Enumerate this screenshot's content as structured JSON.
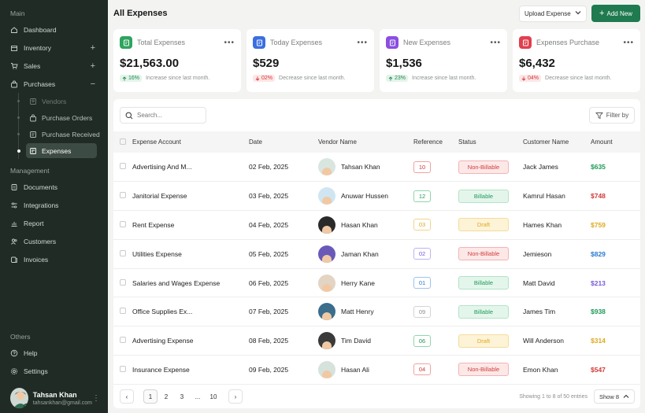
{
  "sidebar": {
    "main_label": "Main",
    "management_label": "Management",
    "others_label": "Others",
    "main_items": [
      {
        "label": "Dashboard",
        "icon": "home-icon"
      },
      {
        "label": "Inventory",
        "icon": "box-icon",
        "trail": "+"
      },
      {
        "label": "Sales",
        "icon": "cart-icon",
        "trail": "+"
      },
      {
        "label": "Purchases",
        "icon": "bag-icon",
        "trail": "−"
      }
    ],
    "purchase_subitems": [
      {
        "label": "Vendors",
        "icon": "vendor-icon"
      },
      {
        "label": "Purchase Orders",
        "icon": "bag-icon"
      },
      {
        "label": "Purchase Received",
        "icon": "receipt-icon"
      },
      {
        "label": "Expenses",
        "icon": "expense-icon"
      }
    ],
    "management_items": [
      {
        "label": "Documents",
        "icon": "document-icon"
      },
      {
        "label": "Integrations",
        "icon": "sliders-icon"
      },
      {
        "label": "Report",
        "icon": "chart-icon"
      },
      {
        "label": "Customers",
        "icon": "users-icon"
      },
      {
        "label": "Invoices",
        "icon": "invoice-icon"
      }
    ],
    "other_items": [
      {
        "label": "Help",
        "icon": "help-icon"
      },
      {
        "label": "Settings",
        "icon": "gear-icon"
      }
    ],
    "profile": {
      "name": "Tahsan Khan",
      "email": "tahsankhan@gmail.com"
    }
  },
  "header": {
    "title": "All Expenses",
    "upload_label": "Upload Expense",
    "add_label": "Add New"
  },
  "cards": [
    {
      "title": "Total Expenses",
      "value": "$21,563.00",
      "change": "16%",
      "direction": "up",
      "note": "Increase since last month.",
      "color": "#2fa35f"
    },
    {
      "title": "Today Expenses",
      "value": "$529",
      "change": "02%",
      "direction": "down",
      "note": "Decrease since last month.",
      "color": "#3b6fe0"
    },
    {
      "title": "New Expenses",
      "value": "$1,536",
      "change": "23%",
      "direction": "up",
      "note": "Increase since last month.",
      "color": "#8a4fe0"
    },
    {
      "title": "Expenses Purchase",
      "value": "$6,432",
      "change": "04%",
      "direction": "down",
      "note": "Decrease since last month.",
      "color": "#e0404f"
    }
  ],
  "table": {
    "search_placeholder": "Search...",
    "filter_label": "Filter by",
    "columns": [
      "Expense Account",
      "Date",
      "Vendor Name",
      "Reference",
      "Status",
      "Customer Name",
      "Amount"
    ],
    "rows": [
      {
        "account": "Advertising And M...",
        "date": "02 Feb, 2025",
        "vendor": "Tahsan Khan",
        "ref": "10",
        "ref_color": "red",
        "status": "Non-Billable",
        "status_kind": "nonbill",
        "customer": "Jack James",
        "amount": "$635",
        "amount_color": "#1e9a57",
        "av_bg": "#d9e6e0"
      },
      {
        "account": "Janitorial Expense",
        "date": "03 Feb, 2025",
        "vendor": "Anuwar Hussen",
        "ref": "12",
        "ref_color": "green",
        "status": "Billable",
        "status_kind": "bill",
        "customer": "Kamrul Hasan",
        "amount": "$748",
        "amount_color": "#d23a3a",
        "av_bg": "#cfe6f2"
      },
      {
        "account": "Rent Expense",
        "date": "04 Feb, 2025",
        "vendor": "Hasan Khan",
        "ref": "03",
        "ref_color": "yellow",
        "status": "Draft",
        "status_kind": "draft",
        "customer": "Hames Khan",
        "amount": "$759",
        "amount_color": "#e0a91e",
        "av_bg": "#2a2a2a"
      },
      {
        "account": "Utilities Expense",
        "date": "05 Feb, 2025",
        "vendor": "Jaman Khan",
        "ref": "02",
        "ref_color": "purple",
        "status": "Non-Billable",
        "status_kind": "nonbill",
        "customer": "Jemieson",
        "amount": "$829",
        "amount_color": "#2a7bd0",
        "av_bg": "#6a59b8"
      },
      {
        "account": "Salaries and Wages Expense",
        "date": "06 Feb, 2025",
        "vendor": "Herry Kane",
        "ref": "01",
        "ref_color": "blue",
        "status": "Billable",
        "status_kind": "bill",
        "customer": "Matt David",
        "amount": "$213",
        "amount_color": "#7a5bd6",
        "av_bg": "#e3d4c3"
      },
      {
        "account": "Office Supplies Ex...",
        "date": "07 Feb, 2025",
        "vendor": "Matt Henry",
        "ref": "09",
        "ref_color": "gray",
        "status": "Billable",
        "status_kind": "bill",
        "customer": "James Tim",
        "amount": "$938",
        "amount_color": "#1e9a57",
        "av_bg": "#3b6d8c"
      },
      {
        "account": "Advertising Expense",
        "date": "08 Feb, 2025",
        "vendor": "Tim David",
        "ref": "06",
        "ref_color": "green",
        "status": "Draft",
        "status_kind": "draft",
        "customer": "Will Anderson",
        "amount": "$314",
        "amount_color": "#e0a91e",
        "av_bg": "#3a3a3a"
      },
      {
        "account": "Insurance Expense",
        "date": "09 Feb, 2025",
        "vendor": "Hasan Ali",
        "ref": "04",
        "ref_color": "red",
        "status": "Non-Billable",
        "status_kind": "nonbill",
        "customer": "Emon Khan",
        "amount": "$547",
        "amount_color": "#d23a3a",
        "av_bg": "#d6e2dc"
      }
    ]
  },
  "pagination": {
    "prev": "‹",
    "next": "›",
    "pages": [
      "1",
      "2",
      "3",
      "...",
      "10"
    ],
    "current": "1",
    "showing": "Showing 1 to 8 of 50 entries",
    "per_page": "Show 8"
  }
}
